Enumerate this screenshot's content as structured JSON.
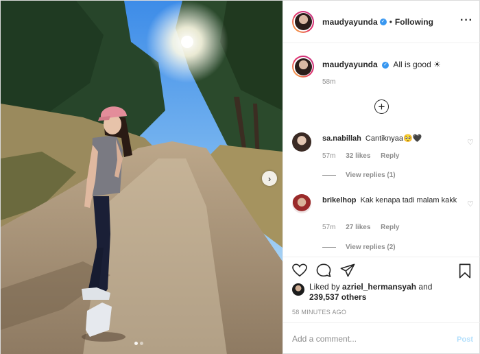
{
  "post": {
    "author": "maudyayunda",
    "separator": "•",
    "follow_status": "Following",
    "more_icon": "more-horizontal-icon",
    "verified_icon": "verified-badge-icon",
    "caption_user": "maudyayunda",
    "caption_text": "All is good ☀",
    "caption_time": "58m",
    "load_more_icon": "plus-circle-icon",
    "photo_next_icon": "chevron-right-icon"
  },
  "comments": [
    {
      "user": "sa.nabillah",
      "text": "Cantiknyaa🥺🖤",
      "time": "57m",
      "likes": "32 likes",
      "reply": "Reply",
      "view_replies": "View replies (1)"
    },
    {
      "user": "brikelhop",
      "text": "Kak kenapa tadi malam kakk",
      "time": "57m",
      "likes": "27 likes",
      "reply": "Reply",
      "view_replies": "View replies (2)"
    }
  ],
  "actions": {
    "like_icon": "heart-icon",
    "comment_icon": "comment-icon",
    "share_icon": "send-icon",
    "save_icon": "bookmark-icon"
  },
  "likes": {
    "prefix": "Liked by ",
    "user": "azriel_hermansyah",
    "and": " and",
    "count": "239,537 others"
  },
  "timestamp": "58 MINUTES AGO",
  "comment_box": {
    "placeholder": "Add a comment...",
    "post_label": "Post"
  },
  "colors": {
    "accent": "#3897f0",
    "post_disabled": "#b2dffc",
    "muted": "#8e8e8e"
  }
}
